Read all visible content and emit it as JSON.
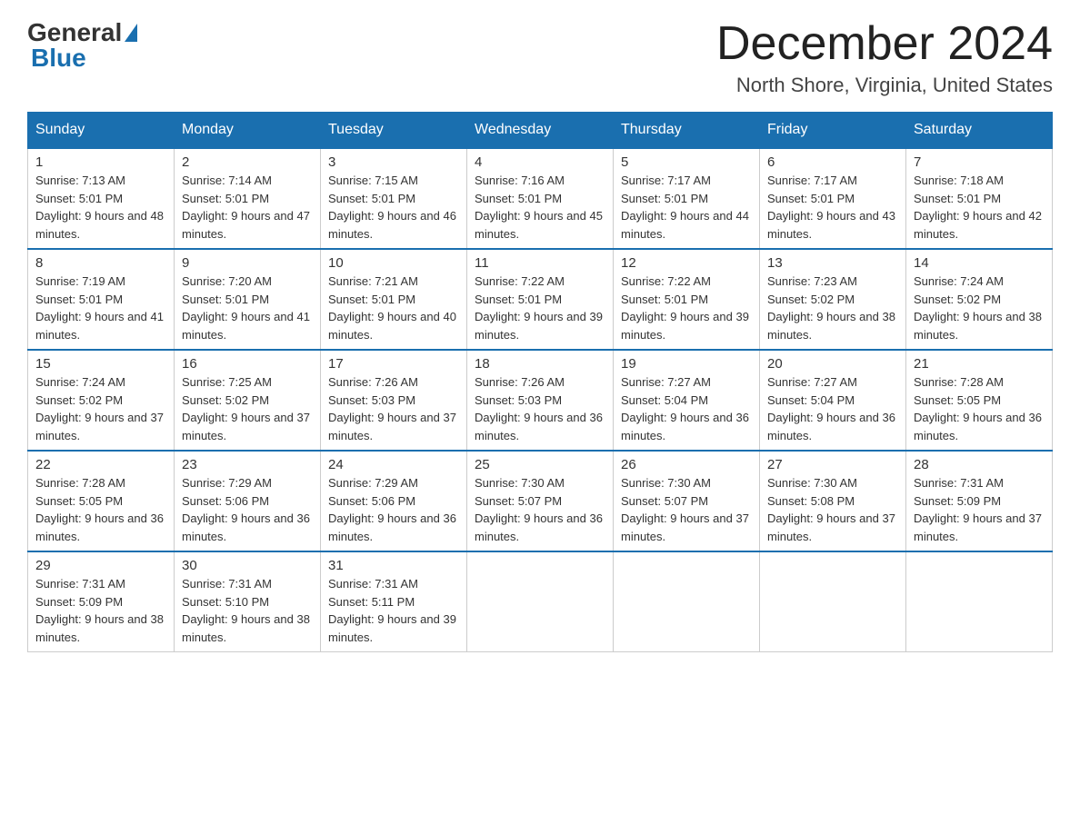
{
  "logo": {
    "text_general": "General",
    "text_blue": "Blue"
  },
  "title": "December 2024",
  "location": "North Shore, Virginia, United States",
  "days_of_week": [
    "Sunday",
    "Monday",
    "Tuesday",
    "Wednesday",
    "Thursday",
    "Friday",
    "Saturday"
  ],
  "weeks": [
    [
      {
        "day": "1",
        "sunrise": "7:13 AM",
        "sunset": "5:01 PM",
        "daylight": "9 hours and 48 minutes."
      },
      {
        "day": "2",
        "sunrise": "7:14 AM",
        "sunset": "5:01 PM",
        "daylight": "9 hours and 47 minutes."
      },
      {
        "day": "3",
        "sunrise": "7:15 AM",
        "sunset": "5:01 PM",
        "daylight": "9 hours and 46 minutes."
      },
      {
        "day": "4",
        "sunrise": "7:16 AM",
        "sunset": "5:01 PM",
        "daylight": "9 hours and 45 minutes."
      },
      {
        "day": "5",
        "sunrise": "7:17 AM",
        "sunset": "5:01 PM",
        "daylight": "9 hours and 44 minutes."
      },
      {
        "day": "6",
        "sunrise": "7:17 AM",
        "sunset": "5:01 PM",
        "daylight": "9 hours and 43 minutes."
      },
      {
        "day": "7",
        "sunrise": "7:18 AM",
        "sunset": "5:01 PM",
        "daylight": "9 hours and 42 minutes."
      }
    ],
    [
      {
        "day": "8",
        "sunrise": "7:19 AM",
        "sunset": "5:01 PM",
        "daylight": "9 hours and 41 minutes."
      },
      {
        "day": "9",
        "sunrise": "7:20 AM",
        "sunset": "5:01 PM",
        "daylight": "9 hours and 41 minutes."
      },
      {
        "day": "10",
        "sunrise": "7:21 AM",
        "sunset": "5:01 PM",
        "daylight": "9 hours and 40 minutes."
      },
      {
        "day": "11",
        "sunrise": "7:22 AM",
        "sunset": "5:01 PM",
        "daylight": "9 hours and 39 minutes."
      },
      {
        "day": "12",
        "sunrise": "7:22 AM",
        "sunset": "5:01 PM",
        "daylight": "9 hours and 39 minutes."
      },
      {
        "day": "13",
        "sunrise": "7:23 AM",
        "sunset": "5:02 PM",
        "daylight": "9 hours and 38 minutes."
      },
      {
        "day": "14",
        "sunrise": "7:24 AM",
        "sunset": "5:02 PM",
        "daylight": "9 hours and 38 minutes."
      }
    ],
    [
      {
        "day": "15",
        "sunrise": "7:24 AM",
        "sunset": "5:02 PM",
        "daylight": "9 hours and 37 minutes."
      },
      {
        "day": "16",
        "sunrise": "7:25 AM",
        "sunset": "5:02 PM",
        "daylight": "9 hours and 37 minutes."
      },
      {
        "day": "17",
        "sunrise": "7:26 AM",
        "sunset": "5:03 PM",
        "daylight": "9 hours and 37 minutes."
      },
      {
        "day": "18",
        "sunrise": "7:26 AM",
        "sunset": "5:03 PM",
        "daylight": "9 hours and 36 minutes."
      },
      {
        "day": "19",
        "sunrise": "7:27 AM",
        "sunset": "5:04 PM",
        "daylight": "9 hours and 36 minutes."
      },
      {
        "day": "20",
        "sunrise": "7:27 AM",
        "sunset": "5:04 PM",
        "daylight": "9 hours and 36 minutes."
      },
      {
        "day": "21",
        "sunrise": "7:28 AM",
        "sunset": "5:05 PM",
        "daylight": "9 hours and 36 minutes."
      }
    ],
    [
      {
        "day": "22",
        "sunrise": "7:28 AM",
        "sunset": "5:05 PM",
        "daylight": "9 hours and 36 minutes."
      },
      {
        "day": "23",
        "sunrise": "7:29 AM",
        "sunset": "5:06 PM",
        "daylight": "9 hours and 36 minutes."
      },
      {
        "day": "24",
        "sunrise": "7:29 AM",
        "sunset": "5:06 PM",
        "daylight": "9 hours and 36 minutes."
      },
      {
        "day": "25",
        "sunrise": "7:30 AM",
        "sunset": "5:07 PM",
        "daylight": "9 hours and 36 minutes."
      },
      {
        "day": "26",
        "sunrise": "7:30 AM",
        "sunset": "5:07 PM",
        "daylight": "9 hours and 37 minutes."
      },
      {
        "day": "27",
        "sunrise": "7:30 AM",
        "sunset": "5:08 PM",
        "daylight": "9 hours and 37 minutes."
      },
      {
        "day": "28",
        "sunrise": "7:31 AM",
        "sunset": "5:09 PM",
        "daylight": "9 hours and 37 minutes."
      }
    ],
    [
      {
        "day": "29",
        "sunrise": "7:31 AM",
        "sunset": "5:09 PM",
        "daylight": "9 hours and 38 minutes."
      },
      {
        "day": "30",
        "sunrise": "7:31 AM",
        "sunset": "5:10 PM",
        "daylight": "9 hours and 38 minutes."
      },
      {
        "day": "31",
        "sunrise": "7:31 AM",
        "sunset": "5:11 PM",
        "daylight": "9 hours and 39 minutes."
      },
      null,
      null,
      null,
      null
    ]
  ]
}
